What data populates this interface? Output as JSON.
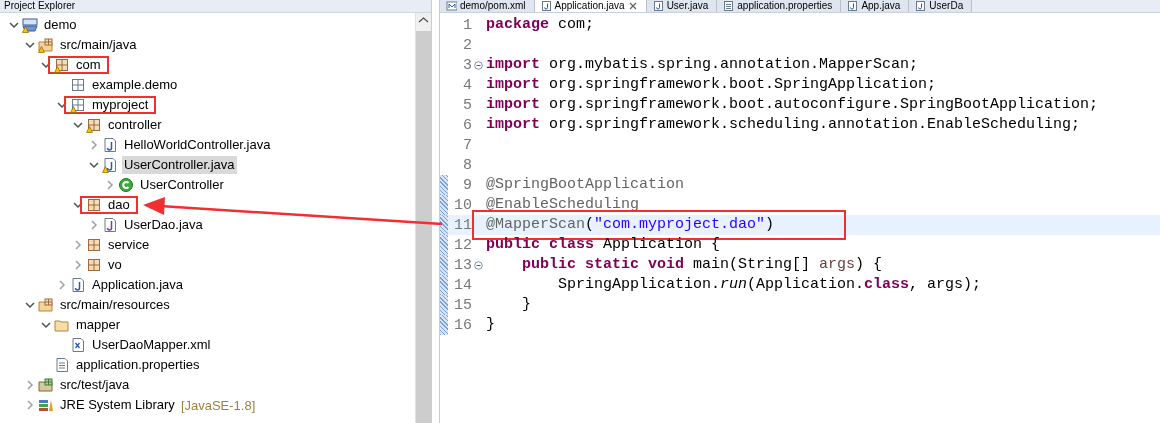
{
  "explorer": {
    "title": "Project Explorer",
    "tree": [
      {
        "label": "demo",
        "kind": "project",
        "warning": true,
        "expanded": true,
        "selected": false,
        "highlighted": false,
        "children": [
          {
            "label": "src/main/java",
            "kind": "source-folder",
            "warning": true,
            "expanded": true,
            "selected": false,
            "highlighted": false,
            "children": [
              {
                "label": "com",
                "kind": "package",
                "warning": true,
                "expanded": true,
                "selected": false,
                "highlighted": true,
                "children": [
                  {
                    "label": "example.demo",
                    "kind": "empty-package",
                    "warning": false,
                    "selected": false,
                    "highlighted": false
                  },
                  {
                    "label": "myproject",
                    "kind": "empty-package",
                    "warning": true,
                    "expanded": true,
                    "selected": false,
                    "highlighted": true,
                    "children": [
                      {
                        "label": "controller",
                        "kind": "package",
                        "warning": true,
                        "expanded": true,
                        "selected": false,
                        "highlighted": false,
                        "children": [
                          {
                            "label": "HelloWorldController.java",
                            "kind": "java-file",
                            "warning": false,
                            "expanded": false,
                            "selected": false,
                            "highlighted": false
                          },
                          {
                            "label": "UserController.java",
                            "kind": "java-file",
                            "warning": true,
                            "expanded": true,
                            "selected": true,
                            "highlighted": false,
                            "children": [
                              {
                                "label": "UserController",
                                "kind": "class",
                                "warning": false,
                                "expanded": false,
                                "selected": false,
                                "highlighted": false
                              }
                            ]
                          }
                        ]
                      },
                      {
                        "label": "dao",
                        "kind": "package",
                        "warning": false,
                        "expanded": true,
                        "selected": false,
                        "highlighted": true,
                        "children": [
                          {
                            "label": "UserDao.java",
                            "kind": "interface-file",
                            "warning": false,
                            "expanded": false,
                            "selected": false,
                            "highlighted": false
                          }
                        ]
                      },
                      {
                        "label": "service",
                        "kind": "package",
                        "warning": false,
                        "expanded": false,
                        "selected": false,
                        "highlighted": false
                      },
                      {
                        "label": "vo",
                        "kind": "package",
                        "warning": false,
                        "expanded": false,
                        "selected": false,
                        "highlighted": false
                      }
                    ]
                  },
                  {
                    "label": "Application.java",
                    "kind": "java-file",
                    "warning": false,
                    "expanded": false,
                    "selected": false,
                    "highlighted": false
                  }
                ]
              }
            ]
          },
          {
            "label": "src/main/resources",
            "kind": "source-folder",
            "warning": false,
            "expanded": true,
            "selected": false,
            "highlighted": false,
            "children": [
              {
                "label": "mapper",
                "kind": "folder",
                "warning": false,
                "expanded": true,
                "selected": false,
                "highlighted": false,
                "children": [
                  {
                    "label": "UserDaoMapper.xml",
                    "kind": "xml-file",
                    "warning": false,
                    "selected": false,
                    "highlighted": false
                  }
                ]
              },
              {
                "label": "application.properties",
                "kind": "text-file",
                "warning": false,
                "selected": false,
                "highlighted": false
              }
            ]
          },
          {
            "label": "src/test/java",
            "kind": "test-folder",
            "warning": false,
            "expanded": false,
            "selected": false,
            "highlighted": false
          },
          {
            "label": "JRE System Library",
            "decoration": "[JavaSE-1.8]",
            "kind": "library",
            "warning": false,
            "expanded": false,
            "selected": false,
            "highlighted": false
          }
        ]
      }
    ]
  },
  "editor": {
    "tabs": [
      {
        "label": "demo/pom.xml",
        "kind": "maven",
        "selected": false
      },
      {
        "label": "Application.java",
        "kind": "java",
        "selected": true
      },
      {
        "label": "User.java",
        "kind": "java",
        "selected": false
      },
      {
        "label": "application.properties",
        "kind": "text",
        "selected": false
      },
      {
        "label": "App.java",
        "kind": "java",
        "selected": false
      },
      {
        "label": "UserDa",
        "kind": "java",
        "selected": false
      }
    ],
    "lines": [
      {
        "number": "1",
        "changed": false,
        "foldable": false,
        "highlighted": false,
        "tokens": [
          {
            "kind": "keyword",
            "text": "package"
          },
          {
            "kind": "plain",
            "text": " com;"
          }
        ]
      },
      {
        "number": "2",
        "changed": false,
        "foldable": false,
        "highlighted": false
      },
      {
        "number": "3",
        "changed": false,
        "foldable": true,
        "highlighted": false,
        "tokens": [
          {
            "kind": "keyword",
            "text": "import"
          },
          {
            "kind": "plain",
            "text": " org.mybatis.spring.annotation.MapperScan;"
          }
        ]
      },
      {
        "number": "4",
        "changed": false,
        "foldable": false,
        "highlighted": false,
        "tokens": [
          {
            "kind": "keyword",
            "text": "import"
          },
          {
            "kind": "plain",
            "text": " org.springframework.boot.SpringApplication;"
          }
        ]
      },
      {
        "number": "5",
        "changed": false,
        "foldable": false,
        "highlighted": false,
        "tokens": [
          {
            "kind": "keyword",
            "text": "import"
          },
          {
            "kind": "plain",
            "text": " org.springframework.boot.autoconfigure.SpringBootApplication;"
          }
        ]
      },
      {
        "number": "6",
        "changed": false,
        "foldable": false,
        "highlighted": false,
        "tokens": [
          {
            "kind": "keyword",
            "text": "import"
          },
          {
            "kind": "plain",
            "text": " org.springframework.scheduling.annotation.EnableScheduling;"
          }
        ]
      },
      {
        "number": "7",
        "changed": false,
        "foldable": false,
        "highlighted": false
      },
      {
        "number": "8",
        "changed": false,
        "foldable": false,
        "highlighted": false
      },
      {
        "number": "9",
        "changed": true,
        "foldable": false,
        "highlighted": false,
        "tokens": [
          {
            "kind": "annotation",
            "text": "@SpringBootApplication"
          }
        ]
      },
      {
        "number": "10",
        "changed": true,
        "foldable": false,
        "highlighted": false,
        "tokens": [
          {
            "kind": "annotation",
            "text": "@EnableScheduling"
          }
        ]
      },
      {
        "number": "11",
        "changed": true,
        "foldable": false,
        "highlighted": true,
        "tokens": [
          {
            "kind": "annotation",
            "text": "@MapperScan"
          },
          {
            "kind": "plain",
            "text": "("
          },
          {
            "kind": "string",
            "text": "\"com.myproject.dao\""
          },
          {
            "kind": "plain",
            "text": ")"
          }
        ]
      },
      {
        "number": "12",
        "changed": true,
        "foldable": false,
        "highlighted": false,
        "tokens": [
          {
            "kind": "keyword",
            "text": "public"
          },
          {
            "kind": "keyword",
            "text": " class"
          },
          {
            "kind": "plain",
            "text": " Application {"
          }
        ]
      },
      {
        "number": "13",
        "changed": true,
        "foldable": true,
        "highlighted": false,
        "tokens": [
          {
            "kind": "keyword",
            "text": "    public"
          },
          {
            "kind": "keyword",
            "text": " static"
          },
          {
            "kind": "keyword",
            "text": " void"
          },
          {
            "kind": "plain",
            "text": " main(String[] "
          },
          {
            "kind": "parameter",
            "text": "args"
          },
          {
            "kind": "plain",
            "text": ") {"
          }
        ]
      },
      {
        "number": "14",
        "changed": true,
        "foldable": false,
        "highlighted": false,
        "tokens": [
          {
            "kind": "plain",
            "text": "        SpringApplication."
          },
          {
            "kind": "method",
            "text": "run"
          },
          {
            "kind": "plain",
            "text": "(Application."
          },
          {
            "kind": "keyword",
            "text": "class"
          },
          {
            "kind": "plain",
            "text": ", args);"
          }
        ]
      },
      {
        "number": "15",
        "changed": true,
        "foldable": false,
        "highlighted": false,
        "tokens": [
          {
            "kind": "plain",
            "text": "    }"
          }
        ]
      },
      {
        "number": "16",
        "changed": true,
        "foldable": false,
        "highlighted": false,
        "tokens": [
          {
            "kind": "plain",
            "text": "}"
          }
        ]
      }
    ]
  }
}
